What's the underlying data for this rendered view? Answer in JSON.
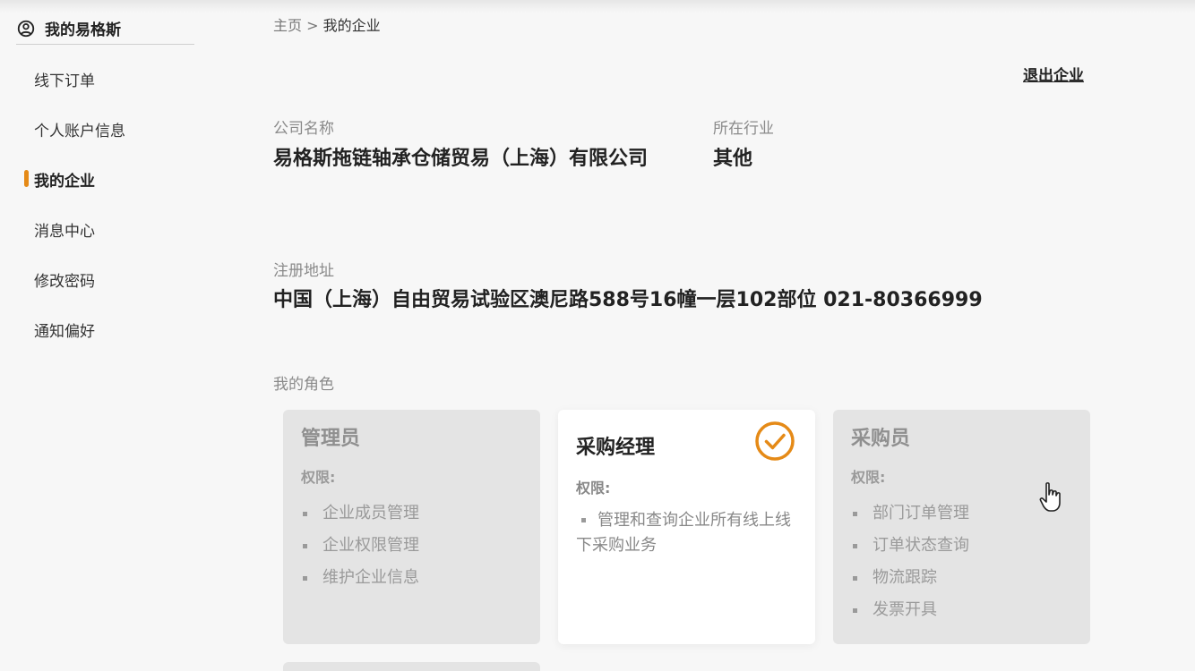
{
  "sidebar": {
    "title": "我的易格斯",
    "items": [
      {
        "label": "线下订单"
      },
      {
        "label": "个人账户信息"
      },
      {
        "label": "我的企业"
      },
      {
        "label": "消息中心"
      },
      {
        "label": "修改密码"
      },
      {
        "label": "通知偏好"
      }
    ],
    "active_index": 2
  },
  "breadcrumb": {
    "home": "主页",
    "separator": ">",
    "current": "我的企业"
  },
  "exit_label": "退出企业",
  "company": {
    "name_label": "公司名称",
    "name": "易格斯拖链轴承仓储贸易（上海）有限公司",
    "industry_label": "所在行业",
    "industry": "其他",
    "address_label": "注册地址",
    "address": "中国（上海）自由贸易试验区澳尼路588号16幢一层102部位 021-80366999"
  },
  "roles": {
    "label": "我的角色",
    "perm_label": "权限:",
    "cards": [
      {
        "title": "管理员",
        "items": [
          "企业成员管理",
          "企业权限管理",
          "维护企业信息"
        ],
        "selected": false
      },
      {
        "title": "采购经理",
        "items": [
          "管理和查询企业所有线上线下采购业务"
        ],
        "selected": true
      },
      {
        "title": "采购员",
        "items": [
          "部门订单管理",
          "订单状态查询",
          "物流跟踪",
          "发票开具"
        ],
        "selected": false
      }
    ]
  },
  "colors": {
    "accent": "#e58a17",
    "background": "#f7f7f7",
    "card_inactive": "#e4e4e4"
  },
  "icons": {
    "sidebar_head": "user-circle-icon",
    "selected_role": "check-circle-icon",
    "cursor": "hand-pointer-icon"
  }
}
